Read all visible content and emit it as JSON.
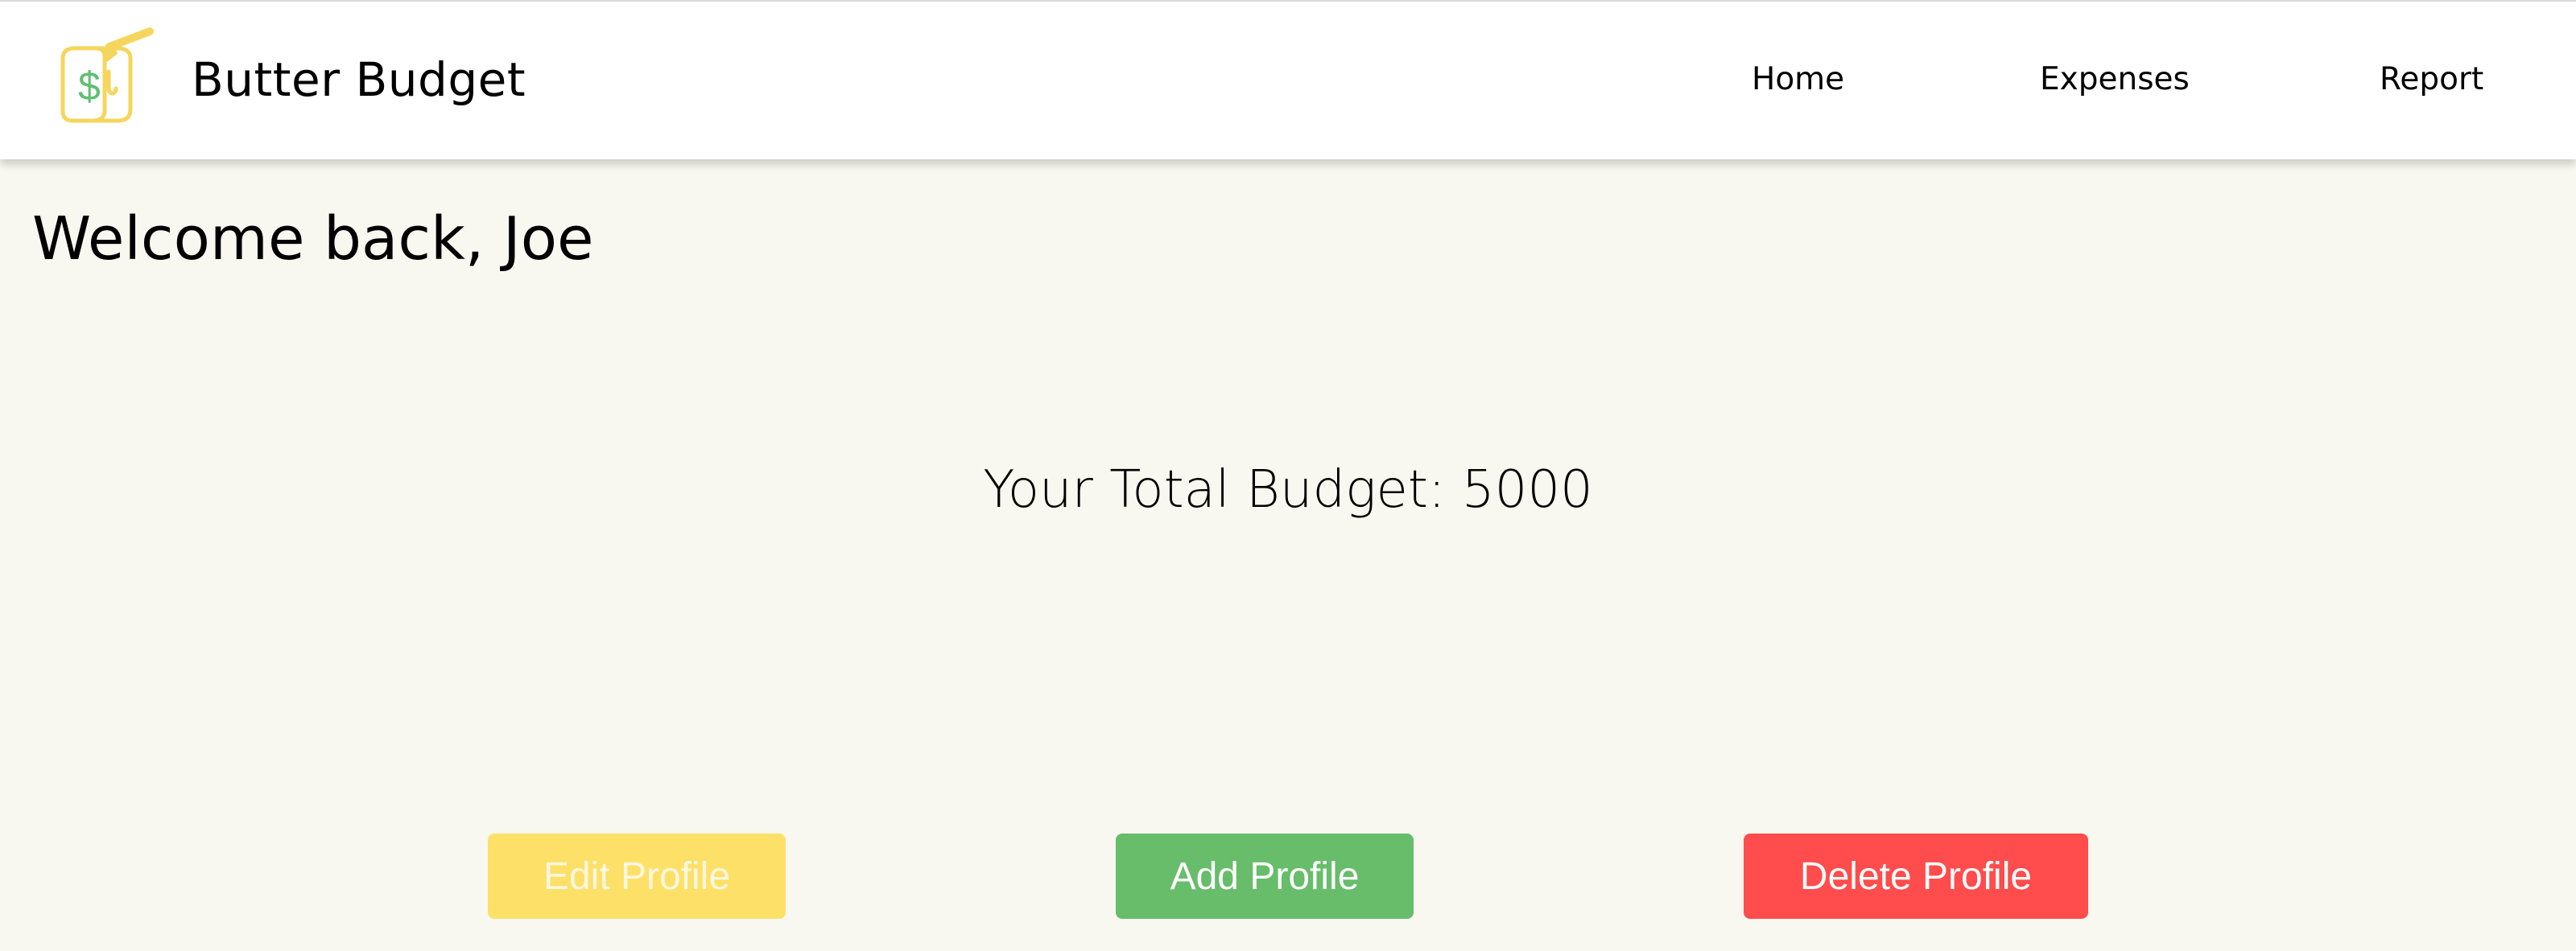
{
  "header": {
    "brand": {
      "logo_icon": "butter-dollar-logo-icon",
      "title": "Butter Budget"
    },
    "nav": [
      {
        "label": "Home"
      },
      {
        "label": "Expenses"
      },
      {
        "label": "Report"
      }
    ]
  },
  "main": {
    "welcome": "Welcome back, Joe",
    "budget_text": "Your Total Budget: 5000",
    "buttons": {
      "edit": "Edit Profile",
      "add": "Add Profile",
      "delete": "Delete Profile"
    }
  },
  "colors": {
    "page_background": "#f8f7f0",
    "header_background": "#ffffff",
    "edit_button": "#fde068",
    "add_button": "#67bd6a",
    "delete_button": "#ff4c4c",
    "logo_yellow": "#f5d65c",
    "logo_green": "#5fbf72"
  }
}
